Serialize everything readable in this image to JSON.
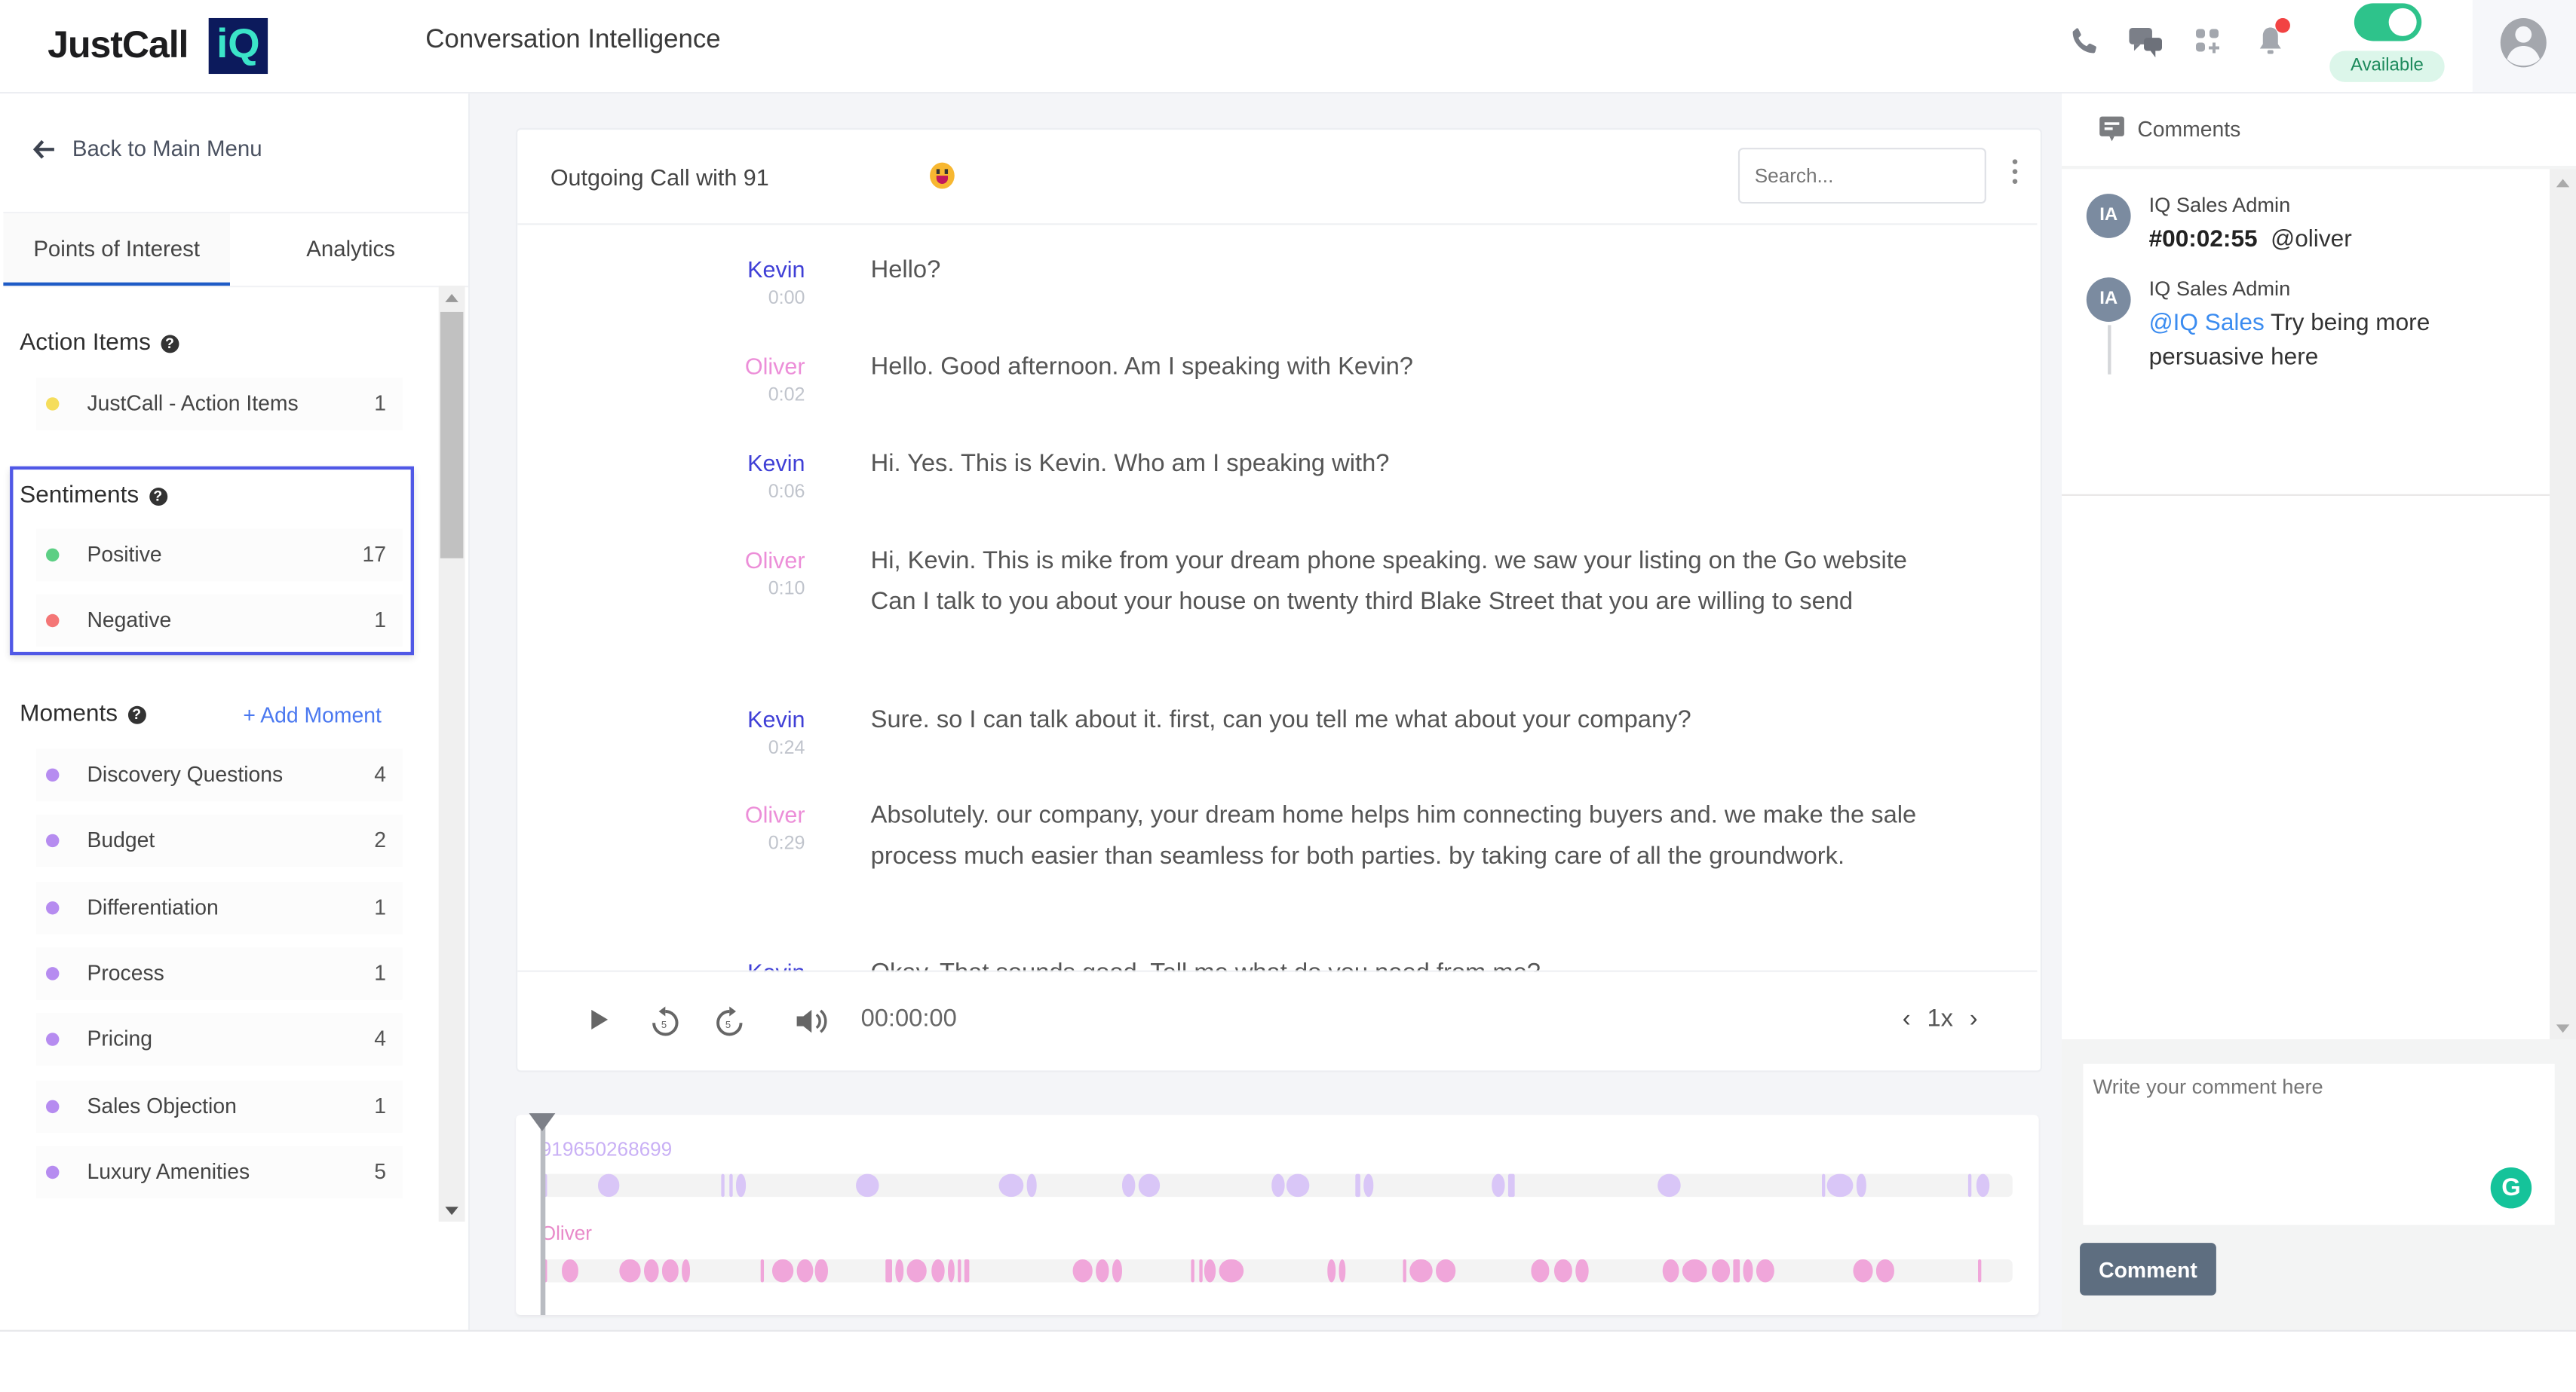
{
  "header": {
    "logo_text": "JustCall",
    "logo_badge": "iQ",
    "app_title": "Conversation Intelligence",
    "icons": [
      "phone-icon",
      "chat-icon",
      "apps-icon",
      "bell-icon"
    ],
    "notification_dot_color": "#f24343",
    "availability": {
      "on": true,
      "label": "Available",
      "color": "#2ec38b"
    }
  },
  "sidebar": {
    "back_label": "Back to Main Menu",
    "tabs": [
      {
        "label": "Points of Interest",
        "active": true
      },
      {
        "label": "Analytics",
        "active": false
      }
    ],
    "action_items": {
      "title": "Action Items",
      "items": [
        {
          "label": "JustCall - Action Items",
          "count": "1",
          "color": "#f5dd5b"
        }
      ]
    },
    "sentiments": {
      "title": "Sentiments",
      "items": [
        {
          "label": "Positive",
          "count": "17",
          "color": "#5ccf84"
        },
        {
          "label": "Negative",
          "count": "1",
          "color": "#f47676"
        }
      ]
    },
    "moments": {
      "title": "Moments",
      "add_label": "+ Add Moment",
      "items": [
        {
          "label": "Discovery Questions",
          "count": "4",
          "color": "#b68cf0"
        },
        {
          "label": "Budget",
          "count": "2",
          "color": "#b68cf0"
        },
        {
          "label": "Differentiation",
          "count": "1",
          "color": "#b68cf0"
        },
        {
          "label": "Process",
          "count": "1",
          "color": "#b68cf0"
        },
        {
          "label": "Pricing",
          "count": "4",
          "color": "#b68cf0"
        },
        {
          "label": "Sales Objection",
          "count": "1",
          "color": "#b68cf0"
        },
        {
          "label": "Luxury Amenities",
          "count": "5",
          "color": "#b68cf0"
        }
      ]
    }
  },
  "call": {
    "title": "Outgoing Call with 91",
    "mood": "laughing-emoji",
    "search_placeholder": "Search...",
    "speaker_colors": {
      "Kevin": "#3f3fd6",
      "Oliver": "#ec8ed8"
    },
    "transcript": [
      {
        "speaker": "Kevin",
        "time": "0:00",
        "text": "Hello?"
      },
      {
        "speaker": "Oliver",
        "time": "0:02",
        "text": "Hello. Good afternoon. Am I speaking with Kevin?"
      },
      {
        "speaker": "Kevin",
        "time": "0:06",
        "text": "Hi. Yes. This is Kevin. Who am I speaking with?"
      },
      {
        "speaker": "Oliver",
        "time": "0:10",
        "text": "Hi, Kevin. This is mike from your dream phone speaking. we saw your listing on the Go website Can I talk to you about your house on twenty third Blake Street that you are willing to send"
      },
      {
        "speaker": "Kevin",
        "time": "0:24",
        "text": "Sure. so I can talk about it. first, can you tell me what about your company?"
      },
      {
        "speaker": "Oliver",
        "time": "0:29",
        "text": "Absolutely. our company, your dream home helps him connecting buyers and. we make the sale process much easier than seamless for both parties. by taking care of all the groundwork."
      },
      {
        "speaker": "Kevin",
        "time": "",
        "text": "Okay. That sounds good. Tell me what do you need from me?"
      }
    ],
    "player": {
      "current_time": "00:00:00",
      "speed": "1x",
      "progress": 0
    }
  },
  "timeline": {
    "tracks": [
      {
        "label": "919650268699",
        "color": "#d9c6f7",
        "label_color": "#c9b0f5",
        "segments": [
          [
            0.0,
            0.002
          ],
          [
            0.037,
            0.052
          ],
          [
            0.121,
            0.123
          ],
          [
            0.126,
            0.129
          ],
          [
            0.131,
            0.138
          ],
          [
            0.213,
            0.228
          ],
          [
            0.31,
            0.327
          ],
          [
            0.329,
            0.336
          ],
          [
            0.394,
            0.403
          ],
          [
            0.405,
            0.42
          ],
          [
            0.495,
            0.504
          ],
          [
            0.506,
            0.521
          ],
          [
            0.553,
            0.556
          ],
          [
            0.558,
            0.565
          ],
          [
            0.645,
            0.654
          ],
          [
            0.657,
            0.661
          ],
          [
            0.758,
            0.774
          ],
          [
            0.87,
            0.872
          ],
          [
            0.874,
            0.891
          ],
          [
            0.894,
            0.9
          ],
          [
            0.97,
            0.972
          ],
          [
            0.975,
            0.984
          ]
        ]
      },
      {
        "label": "Oliver",
        "color": "#f0a6da",
        "label_color": "#e88ac9",
        "segments": [
          [
            0.0,
            0.002
          ],
          [
            0.012,
            0.024
          ],
          [
            0.052,
            0.066
          ],
          [
            0.068,
            0.078
          ],
          [
            0.08,
            0.092
          ],
          [
            0.094,
            0.1
          ],
          [
            0.148,
            0.149
          ],
          [
            0.156,
            0.17
          ],
          [
            0.172,
            0.183
          ],
          [
            0.185,
            0.193
          ],
          [
            0.233,
            0.237
          ],
          [
            0.239,
            0.245
          ],
          [
            0.247,
            0.261
          ],
          [
            0.264,
            0.273
          ],
          [
            0.275,
            0.28
          ],
          [
            0.282,
            0.284
          ],
          [
            0.286,
            0.29
          ],
          [
            0.36,
            0.374
          ],
          [
            0.376,
            0.385
          ],
          [
            0.387,
            0.394
          ],
          [
            0.441,
            0.443
          ],
          [
            0.446,
            0.448
          ],
          [
            0.45,
            0.458
          ],
          [
            0.46,
            0.476
          ],
          [
            0.533,
            0.539
          ],
          [
            0.541,
            0.546
          ],
          [
            0.585,
            0.587
          ],
          [
            0.59,
            0.605
          ],
          [
            0.607,
            0.621
          ],
          [
            0.672,
            0.685
          ],
          [
            0.688,
            0.7
          ],
          [
            0.703,
            0.711
          ],
          [
            0.762,
            0.773
          ],
          [
            0.775,
            0.792
          ],
          [
            0.795,
            0.808
          ],
          [
            0.81,
            0.814
          ],
          [
            0.816,
            0.823
          ],
          [
            0.826,
            0.838
          ],
          [
            0.892,
            0.905
          ],
          [
            0.907,
            0.92
          ],
          [
            0.976,
            0.979
          ]
        ]
      }
    ]
  },
  "comments": {
    "title": "Comments",
    "items": [
      {
        "initials": "IA",
        "author": "IQ Sales Admin",
        "timestamp": "#00:02:55",
        "mention": "@oliver",
        "text": ""
      },
      {
        "initials": "IA",
        "author": "IQ Sales Admin",
        "timestamp": "",
        "mention": "@IQ Sales",
        "text": "Try being more persuasive here"
      }
    ],
    "input_placeholder": "Write your comment here",
    "submit_label": "Comment"
  }
}
